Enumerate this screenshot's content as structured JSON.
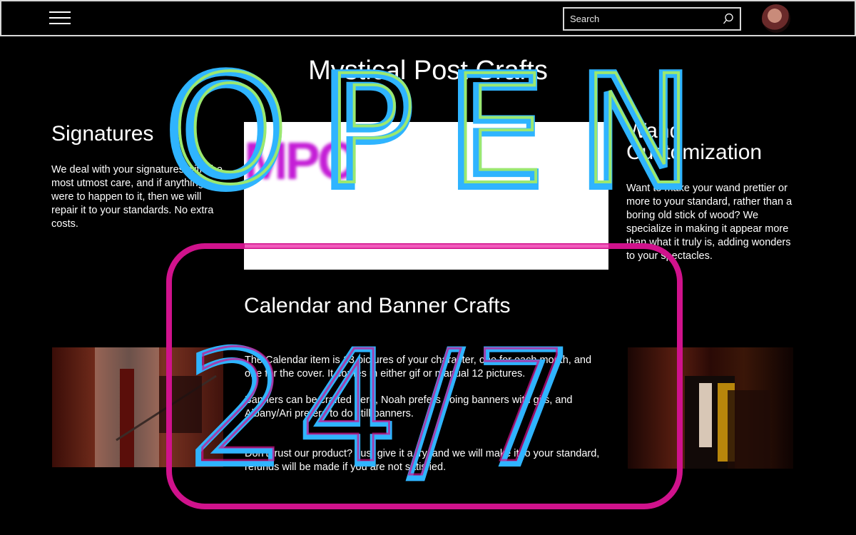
{
  "header": {
    "search": {
      "placeholder": "Search"
    }
  },
  "overlay": {
    "word_top": "OPEN",
    "word_bottom": "24/7",
    "colors": {
      "cyan": "#2fb4ff",
      "green": "#9be870",
      "magenta": "#d0128c",
      "teal": "#2fb4ff"
    }
  },
  "page": {
    "title": "Mystical Post Crafts"
  },
  "signatures": {
    "title": "Signatures",
    "body": "We deal with your signatures with the most utmost care, and if anything were to happen to it, then we will repair it to your standards. No extra costs."
  },
  "hero": {
    "logo_text": "MPC"
  },
  "wand": {
    "title_line1": "Wand",
    "title_line2": "Customization",
    "body": "Want to make your wand prettier or more to your standard, rather than a boring old stick of wood? We specialize in making it appear more than what it truly is, adding wonders to your spectacles."
  },
  "calendar": {
    "title": "Calendar and Banner Crafts",
    "para1": "The Calendar item is 13 pictures of your character, one for each month, and one for the cover. It comes in either gif or manual 12 pictures.",
    "para2": "Banners can be crafted here, Noah prefers doing banners with gifs, and Albany/Ari prefers to do still banners.",
    "para3": "Don't trust our product? Just give it a try, and we will make it to your standard, refunds will be made if you are not satisfied."
  },
  "icons": [
    "menu-icon",
    "search-icon",
    "avatar"
  ]
}
